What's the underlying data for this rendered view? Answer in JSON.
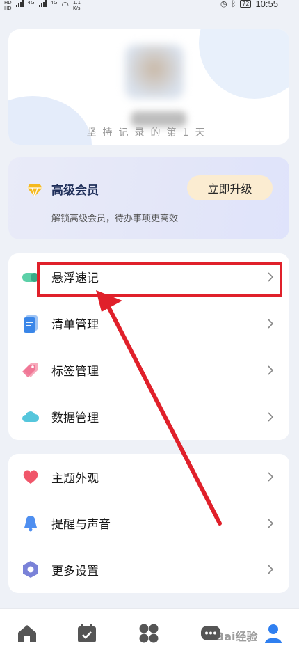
{
  "status_bar": {
    "left_badges": [
      "HD",
      "HD"
    ],
    "network_tags": [
      "4G",
      "4G"
    ],
    "speed_value": "1.1",
    "speed_unit": "K/s",
    "battery": "72",
    "time": "10:55"
  },
  "profile": {
    "slogan": "坚持记录的第1天"
  },
  "vip": {
    "title": "高级会员",
    "subtitle": "解锁高级会员，待办事项更高效",
    "button_label": "立即升级"
  },
  "menu_group_1": [
    {
      "label": "悬浮速记",
      "icon": "capsule-icon"
    },
    {
      "label": "清单管理",
      "icon": "list-icon"
    },
    {
      "label": "标签管理",
      "icon": "tag-icon"
    },
    {
      "label": "数据管理",
      "icon": "cloud-icon"
    }
  ],
  "menu_group_2": [
    {
      "label": "主题外观",
      "icon": "heart-icon"
    },
    {
      "label": "提醒与声音",
      "icon": "bell-icon"
    },
    {
      "label": "更多设置",
      "icon": "hexagon-settings-icon"
    }
  ],
  "bottom_nav": [
    {
      "icon": "home-icon"
    },
    {
      "icon": "calendar-check-icon"
    },
    {
      "icon": "grid-icon"
    },
    {
      "icon": "chat-icon"
    },
    {
      "icon": "profile-icon",
      "active": true
    }
  ],
  "watermark": "Bai经验",
  "colors": {
    "accent_red": "#e0202a",
    "vip_button_bg": "#fbecd1",
    "page_bg": "#eef1f7"
  }
}
